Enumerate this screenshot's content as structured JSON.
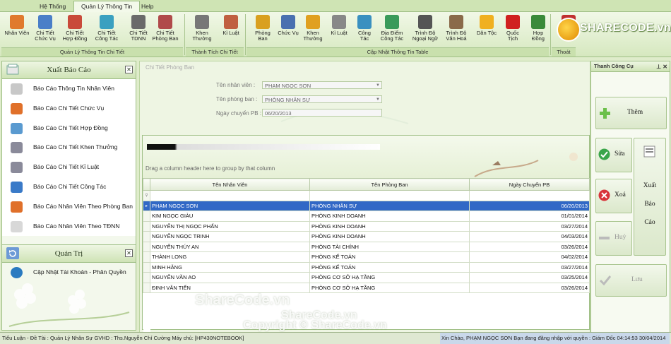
{
  "tabs": [
    "Hệ Thống",
    "Quản Lý Thông Tin",
    "Help"
  ],
  "ribbon": {
    "buttons": [
      {
        "label": "Nhân Viên",
        "icon": "employee-icon",
        "color": "#e07a2e"
      },
      {
        "label": "Chi Tiết\nChức Vụ",
        "icon": "position-detail-icon",
        "color": "#4a7fc8"
      },
      {
        "label": "Chi Tiết\nHợp Đồng",
        "icon": "contract-detail-icon",
        "color": "#c94a3a"
      },
      {
        "label": "Chi Tiết\nCông Tác",
        "icon": "work-detail-icon",
        "color": "#3aa0c0"
      },
      {
        "label": "Chi Tiết\nTDNN",
        "icon": "language-detail-icon",
        "color": "#6a6a6a"
      },
      {
        "label": "Chi Tiết\nPhòng Ban",
        "icon": "department-detail-icon",
        "color": "#b04a4a"
      },
      {
        "label": "Khen\nThưởng",
        "icon": "reward-icon",
        "color": "#777"
      },
      {
        "label": "Kỉ Luật",
        "icon": "discipline-icon",
        "color": "#c06040"
      },
      {
        "label": "Phòng\nBan",
        "icon": "department-icon",
        "color": "#d9a020"
      },
      {
        "label": "Chức Vụ",
        "icon": "position-icon",
        "color": "#4a70b0"
      },
      {
        "label": "Khen\nThưởng",
        "icon": "reward-update-icon",
        "color": "#e0a020"
      },
      {
        "label": "Kỉ Luật",
        "icon": "discipline-update-icon",
        "color": "#888"
      },
      {
        "label": "Công\nTác",
        "icon": "work-icon",
        "color": "#3a90c0"
      },
      {
        "label": "Địa Điểm\nCông Tác",
        "icon": "location-icon",
        "color": "#3a9a5a"
      },
      {
        "label": "Trình Độ\nNgoại Ngữ",
        "icon": "foreign-language-icon",
        "color": "#555"
      },
      {
        "label": "Trình Độ\nVăn Hoá",
        "icon": "education-icon",
        "color": "#8a6a4a"
      },
      {
        "label": "Dân Tộc",
        "icon": "star-icon",
        "color": "#f0b020"
      },
      {
        "label": "Quốc\nTịch",
        "icon": "flag-icon",
        "color": "#d02020"
      },
      {
        "label": "Hợp\nĐồng",
        "icon": "contract-icon",
        "color": "#3a8a3a"
      },
      {
        "label": "Exit",
        "icon": "exit-icon",
        "color": "#c03030"
      }
    ],
    "groups": [
      "Quản Lý Thông Tin Chi Tiết",
      "Thành Tích Chi Tiết",
      "Cập Nhật Thông Tin Table",
      "Thoát"
    ]
  },
  "logo": {
    "text": "SHARECODE.vn"
  },
  "left": {
    "report_title": "Xuất Báo Cáo",
    "reports": [
      {
        "label": "Báo Cáo Thông Tin Nhân Viên",
        "icon": "document-report-icon"
      },
      {
        "label": "Báo Cáo Chi Tiết Chức Vụ",
        "icon": "users-report-icon"
      },
      {
        "label": "Báo Cáo Chi Tiết Hợp Đồng",
        "icon": "pencil-report-icon"
      },
      {
        "label": "Báo Cáo  Chi Tiết Khen Thưởng",
        "icon": "database-report-icon"
      },
      {
        "label": "Báo Cáo Chi Tiết Kỉ Luật",
        "icon": "database-report-icon"
      },
      {
        "label": "Báo Cáo Chi Tiết Công Tác",
        "icon": "globe-report-icon"
      },
      {
        "label": "Báo Cáo Nhân Viên Theo Phòng Ban",
        "icon": "users-report-icon"
      },
      {
        "label": "Báo Cáo Nhân Viên Theo TĐNN",
        "icon": "paper-report-icon"
      }
    ],
    "admin_title": "Quản Trị",
    "admin_items": [
      {
        "label": "Cập Nhật Tài Khoản - Phân Quyền",
        "icon": "settings-icon"
      }
    ]
  },
  "form": {
    "title": "Chi Tiết Phòng Ban",
    "name_label": "Tên nhân viên :",
    "name_value": "PHẠM NGỌC SƠN",
    "dept_label": "Tên phòng ban :",
    "dept_value": "PHÒNG NHÂN SỰ",
    "date_label": "Ngày chuyển PB :",
    "date_value": "06/20/2013"
  },
  "grid": {
    "group_hint": "Drag a column header here to group by that column",
    "columns": [
      "Tên Nhân Viên",
      "Tên Phòng Ban",
      "Ngày Chuyển PB"
    ],
    "rows": [
      [
        "PHẠM NGỌC SƠN",
        "PHÒNG NHÂN SỰ",
        "06/20/2013"
      ],
      [
        "KIM NGỌC GIÀU",
        "PHÒNG KINH DOANH",
        "01/01/2014"
      ],
      [
        "NGUYỄN THỊ NGỌC PHẤN",
        "PHÒNG KINH DOANH",
        "03/27/2014"
      ],
      [
        "NGUYỄN NGỌC TRINH",
        "PHÒNG KINH DOANH",
        "04/03/2014"
      ],
      [
        "NGUYỄN THÚY AN",
        "PHÒNG TÀI CHÍNH",
        "03/26/2014"
      ],
      [
        "THÀNH LONG",
        "PHÒNG KẾ TOÁN",
        "04/02/2014"
      ],
      [
        "MINH HẰNG",
        "PHÒNG KẾ TOÁN",
        "03/27/2014"
      ],
      [
        "NGUYỄN VĂN AO",
        "PHÒNG CƠ SỞ HẠ TẦNG",
        "03/25/2014"
      ],
      [
        "ĐINH VĂN TIẾN",
        "PHÒNG CƠ SỞ HẠ TẦNG",
        "03/26/2014"
      ]
    ],
    "selected_row": 0
  },
  "right": {
    "title": "Thanh Công Cụ",
    "add": "Thêm",
    "edit": "Sửa",
    "delete": "Xoá",
    "cancel": "Huỷ",
    "export_1": "Xuất",
    "export_2": "Báo",
    "export_3": "Cáo",
    "save": "Lưu"
  },
  "status": {
    "left": "Tiểu Luận - Đề Tài : Quản Lý Nhân Sự  GVHD : Ths.Nguyễn Chí Cường  Máy chủ: [HP430NOTEBOOK]",
    "right": "Xin Chào,  PHẠM NGỌC SƠN  Bạn đang đăng nhập với quyền :  Giám Đốc  04:14:53 30/04/2014"
  },
  "watermarks": [
    "ShareCode.vn",
    "ShareCode.vn",
    "Copyright © ShareCode.vn"
  ]
}
